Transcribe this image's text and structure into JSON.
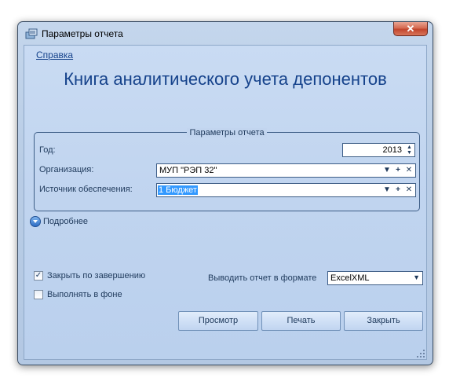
{
  "window": {
    "title": "Параметры отчета",
    "close_label": "✕"
  },
  "help_link": "Справка",
  "report_title": "Книга аналитического учета депонентов",
  "params": {
    "legend": "Параметры отчета",
    "year_label": "Год:",
    "year_value": "2013",
    "org_label": "Организация:",
    "org_value": "МУП \"РЭП 32\"",
    "source_label": "Источник обеспечения:",
    "source_value": "1 Бюджет"
  },
  "more_label": "Подробнее",
  "close_on_finish": {
    "label": "Закрыть по завершению",
    "checked": true
  },
  "run_background": {
    "label": "Выполнять в фоне",
    "checked": false
  },
  "format": {
    "label": "Выводить отчет в формате",
    "value": "ExcelXML"
  },
  "buttons": {
    "preview": "Просмотр",
    "print": "Печать",
    "close": "Закрыть"
  }
}
